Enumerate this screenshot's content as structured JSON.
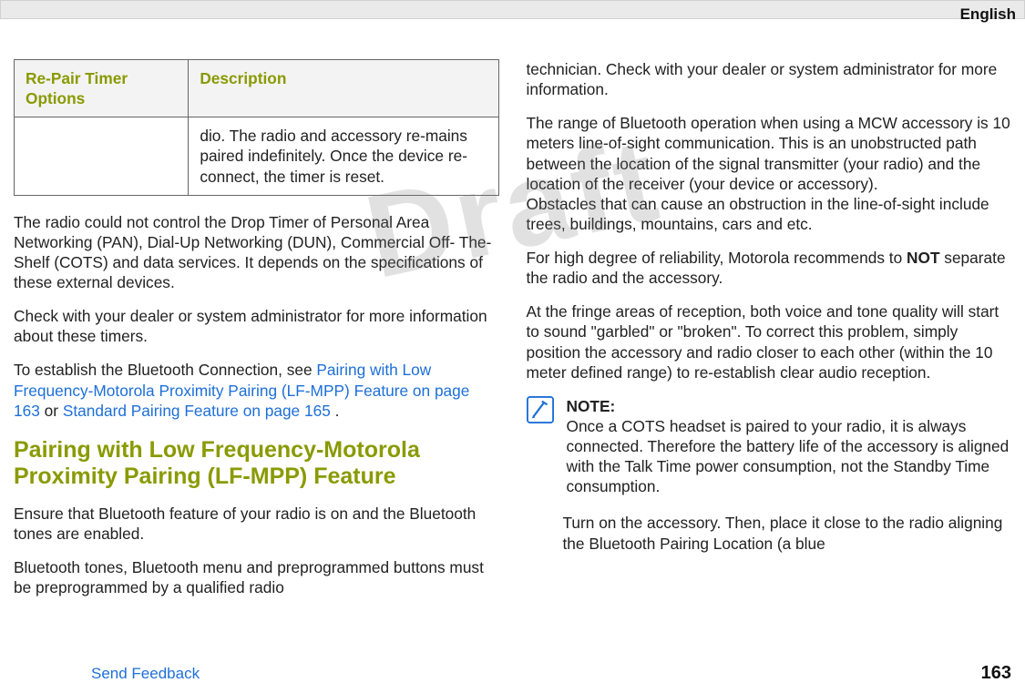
{
  "language_label": "English",
  "watermark": "Draft",
  "table": {
    "header_col1": "Re-Pair Timer Options",
    "header_col2": "Description",
    "row1_col1": "",
    "row1_col2": "dio. The radio and accessory re-mains paired indefinitely. Once the device re-connect, the timer is reset."
  },
  "left": {
    "p1": "The radio could not control the Drop Timer of Personal Area Networking (PAN), Dial-Up Networking (DUN), Commercial Off- The-Shelf (COTS) and data services. It depends on the specifications of these external devices.",
    "p2": "Check with your dealer or system administrator for more information about these timers.",
    "p3_a": "To establish the Bluetooth Connection, see ",
    "p3_link1": "Pairing with Low Frequency-Motorola Proximity Pairing (LF-MPP) Feature on page 163",
    "p3_b": " or ",
    "p3_link2": "Standard Pairing Feature on page 165 ",
    "p3_c": ".",
    "heading": "Pairing with Low Frequency-Motorola Proximity Pairing (LF-MPP) Feature",
    "p4": "Ensure that Bluetooth feature of your radio is on and the Bluetooth tones are enabled.",
    "p5": "Bluetooth tones, Bluetooth menu and preprogrammed buttons must be preprogrammed by a qualified radio "
  },
  "right": {
    "p1": "technician. Check with your dealer or system administrator for more information.",
    "p2": "The range of Bluetooth operation when using a MCW accessory is 10 meters line-of-sight communication. This is an unobstructed path between the location of the signal transmitter (your radio) and the location of the receiver (your device or accessory).",
    "p2b": "Obstacles that can cause an obstruction in the line-of-sight include trees, buildings, mountains, cars and etc.",
    "p3_a": "For high degree of reliability, Motorola recommends to ",
    "p3_bold": "NOT",
    "p3_b": " separate the radio and the accessory.",
    "p4": "At the fringe areas of reception, both voice and tone quality will start to sound \"garbled\" or \"broken\". To correct this problem, simply position the accessory and radio closer to each other (within the 10 meter defined range) to re-establish clear audio reception.",
    "note_label": "NOTE:",
    "note_body": "Once a COTS headset is paired to your radio, it is always connected. Therefore the battery life of the accessory is aligned with the Talk Time power consumption, not the Standby Time consumption.",
    "step1": "Turn on the accessory. Then, place it close to the radio aligning the Bluetooth Pairing Location (a blue"
  },
  "footer": {
    "send_feedback": "Send Feedback",
    "page_number": "163"
  }
}
